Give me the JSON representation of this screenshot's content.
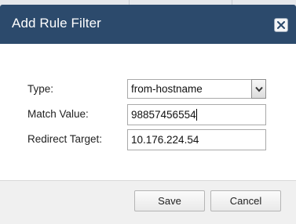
{
  "dialog": {
    "title": "Add Rule Filter",
    "close_icon": "close-icon"
  },
  "form": {
    "type_label": "Type:",
    "type_value": "from-hostname",
    "match_label": "Match Value:",
    "match_value": "98857456554",
    "redirect_label": "Redirect Target:",
    "redirect_value": "10.176.224.54"
  },
  "footer": {
    "save_label": "Save",
    "cancel_label": "Cancel"
  },
  "colors": {
    "titlebar": "#2c4a6c",
    "footer": "#f0f0f0"
  }
}
